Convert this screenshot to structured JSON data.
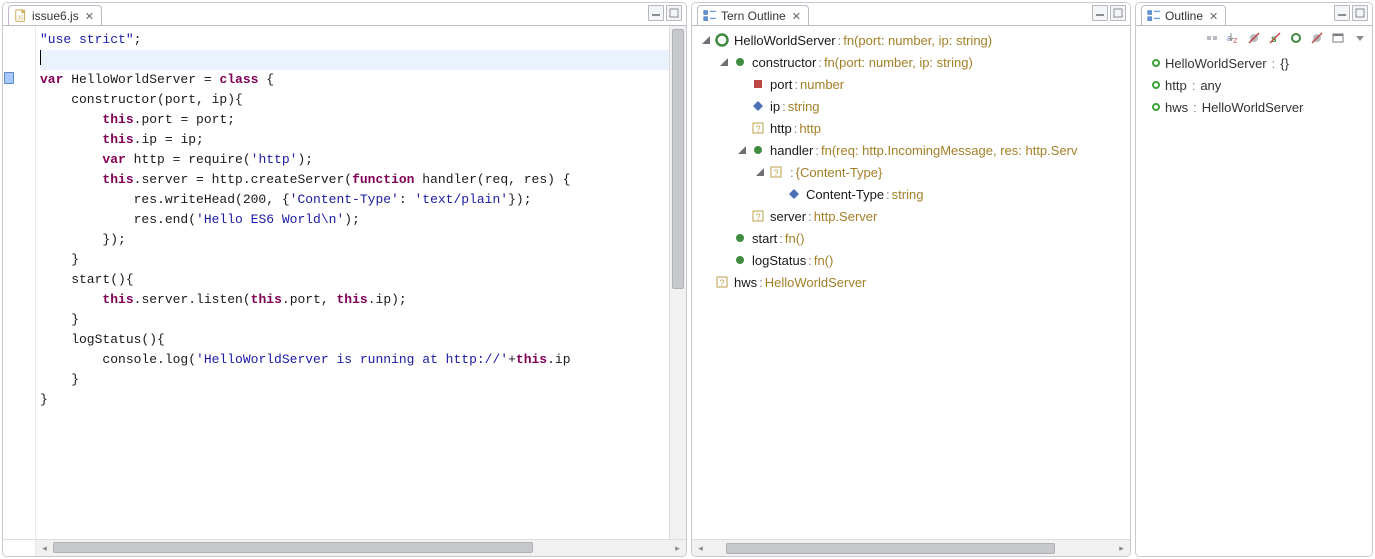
{
  "editor": {
    "tab_title": "issue6.js",
    "code_tokens": [
      [
        [
          "k-blue",
          "\"use strict\""
        ],
        [
          "k-black",
          ";"
        ]
      ],
      "CURSOR_LINE",
      [
        [
          "k-purple",
          "var"
        ],
        [
          "k-black",
          " HelloWorldServer = "
        ],
        [
          "k-purple",
          "class"
        ],
        [
          "k-black",
          " {"
        ]
      ],
      [
        [
          "k-black",
          "    constructor(port, ip){"
        ]
      ],
      [
        [
          "k-black",
          "        "
        ],
        [
          "k-purple",
          "this"
        ],
        [
          "k-black",
          ".port = port;"
        ]
      ],
      [
        [
          "k-black",
          "        "
        ],
        [
          "k-purple",
          "this"
        ],
        [
          "k-black",
          ".ip = ip;"
        ]
      ],
      [
        [
          "k-black",
          ""
        ]
      ],
      [
        [
          "k-black",
          "        "
        ],
        [
          "k-purple",
          "var"
        ],
        [
          "k-black",
          " http = require("
        ],
        [
          "k-blue",
          "'http'"
        ],
        [
          "k-black",
          ");"
        ]
      ],
      [
        [
          "k-black",
          "        "
        ],
        [
          "k-purple",
          "this"
        ],
        [
          "k-black",
          ".server = http.createServer("
        ],
        [
          "k-purple",
          "function"
        ],
        [
          "k-black",
          " handler(req, res) {"
        ]
      ],
      [
        [
          "k-black",
          "            res.writeHead(200, {"
        ],
        [
          "k-blue",
          "'Content-Type'"
        ],
        [
          "k-black",
          ": "
        ],
        [
          "k-blue",
          "'text/plain'"
        ],
        [
          "k-black",
          "});"
        ]
      ],
      [
        [
          "k-black",
          "            res.end("
        ],
        [
          "k-blue",
          "'Hello ES6 World\\n'"
        ],
        [
          "k-black",
          ");"
        ]
      ],
      [
        [
          "k-black",
          "        });"
        ]
      ],
      [
        [
          "k-black",
          "    }"
        ]
      ],
      [
        [
          "k-black",
          ""
        ]
      ],
      [
        [
          "k-black",
          "    start(){"
        ]
      ],
      [
        [
          "k-black",
          "        "
        ],
        [
          "k-purple",
          "this"
        ],
        [
          "k-black",
          ".server.listen("
        ],
        [
          "k-purple",
          "this"
        ],
        [
          "k-black",
          ".port, "
        ],
        [
          "k-purple",
          "this"
        ],
        [
          "k-black",
          ".ip);"
        ]
      ],
      [
        [
          "k-black",
          "    }"
        ]
      ],
      [
        [
          "k-black",
          ""
        ]
      ],
      [
        [
          "k-black",
          "    logStatus(){"
        ]
      ],
      [
        [
          "k-black",
          "        console.log("
        ],
        [
          "k-blue",
          "'HelloWorldServer is running at http://'"
        ],
        [
          "k-black",
          "+"
        ],
        [
          "k-purple",
          "this"
        ],
        [
          "k-black",
          ".ip"
        ]
      ],
      [
        [
          "k-black",
          "    }"
        ]
      ],
      [
        [
          "k-black",
          ""
        ]
      ],
      [
        [
          "k-black",
          ""
        ]
      ],
      [
        [
          "k-black",
          "}"
        ]
      ]
    ]
  },
  "tern": {
    "title": "Tern Outline",
    "nodes": [
      {
        "depth": 0,
        "twisty": "open",
        "icon": "class",
        "label": "HelloWorldServer",
        "type": "fn(port: number, ip: string)"
      },
      {
        "depth": 1,
        "twisty": "open",
        "icon": "method",
        "label": "constructor",
        "type": "fn(port: number, ip: string)"
      },
      {
        "depth": 2,
        "twisty": "none",
        "icon": "field-red",
        "label": "port",
        "type": "number"
      },
      {
        "depth": 2,
        "twisty": "none",
        "icon": "field-blue",
        "label": "ip",
        "type": "string"
      },
      {
        "depth": 2,
        "twisty": "none",
        "icon": "unknown",
        "label": "http",
        "type": "http"
      },
      {
        "depth": 2,
        "twisty": "open",
        "icon": "method",
        "label": "handler",
        "type": "fn(req: http.IncomingMessage, res: http.Serv"
      },
      {
        "depth": 3,
        "twisty": "open",
        "icon": "unknown",
        "label": "",
        "type": "{Content-Type}"
      },
      {
        "depth": 4,
        "twisty": "none",
        "icon": "field-blue",
        "label": "Content-Type",
        "type": "string"
      },
      {
        "depth": 2,
        "twisty": "none",
        "icon": "unknown",
        "label": "server",
        "type": "http.Server"
      },
      {
        "depth": 1,
        "twisty": "none",
        "icon": "method",
        "label": "start",
        "type": "fn()"
      },
      {
        "depth": 1,
        "twisty": "none",
        "icon": "method",
        "label": "logStatus",
        "type": "fn()"
      },
      {
        "depth": 0,
        "twisty": "none",
        "icon": "unknown",
        "label": "hws",
        "type": "HelloWorldServer"
      }
    ]
  },
  "outline": {
    "title": "Outline",
    "items": [
      {
        "label": "HelloWorldServer",
        "type": "{}"
      },
      {
        "label": "http",
        "type": "any"
      },
      {
        "label": "hws",
        "type": "HelloWorldServer"
      }
    ]
  }
}
